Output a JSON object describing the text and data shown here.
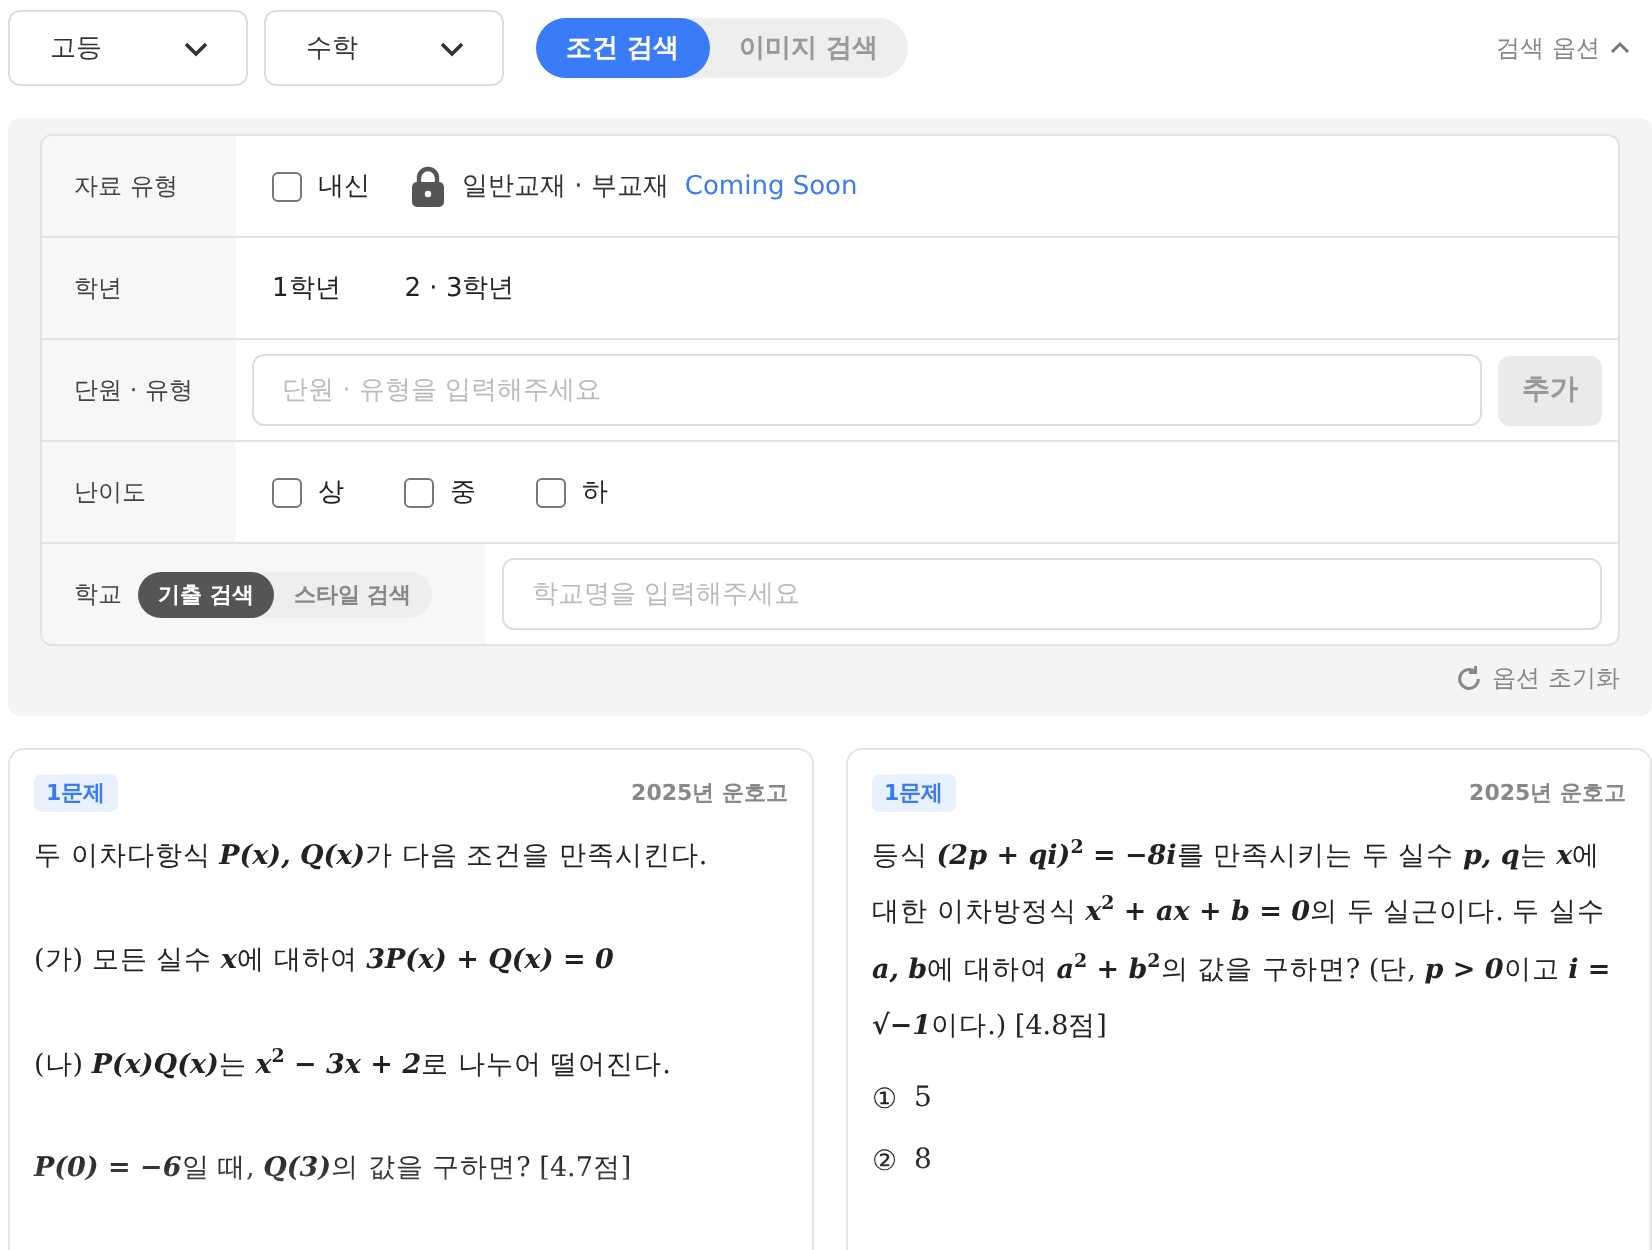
{
  "top_bar": {
    "dropdowns": [
      {
        "label": "고등"
      },
      {
        "label": "수학"
      }
    ],
    "search_tabs": [
      {
        "label": "조건 검색",
        "selected": true
      },
      {
        "label": "이미지 검색",
        "selected": false
      }
    ],
    "options_toggle": {
      "label": "검색 옵션",
      "expanded": true
    }
  },
  "filters": {
    "material": {
      "label": "자료 유형",
      "checkbox": {
        "label": "내신",
        "checked": false
      },
      "locked_label": "일반교재 · 부교재",
      "badge": "Coming Soon"
    },
    "grade": {
      "label": "학년",
      "options": [
        "1학년",
        "2 · 3학년"
      ]
    },
    "unit": {
      "label": "단원 · 유형",
      "placeholder": "단원 · 유형을 입력해주세요",
      "button": "추가"
    },
    "difficulty": {
      "label": "난이도",
      "options": [
        {
          "label": "상",
          "checked": false
        },
        {
          "label": "중",
          "checked": false
        },
        {
          "label": "하",
          "checked": false
        }
      ]
    },
    "school": {
      "label": "학교",
      "modes": [
        {
          "label": "기출 검색",
          "selected": true
        },
        {
          "label": "스타일 검색",
          "selected": false
        }
      ],
      "placeholder": "학교명을 입력해주세요"
    },
    "reset": "옵션 초기화"
  },
  "cards": [
    {
      "badge": "1문제",
      "source": "2025년 운호고",
      "lines": [
        [
          {
            "kind": "text",
            "text": "두 이차다항식 "
          },
          {
            "kind": "math",
            "text": "P(x), Q(x)"
          },
          {
            "kind": "text",
            "text": "가 다음 조건을 만족시킨다."
          }
        ],
        [
          {
            "kind": "text",
            "text": "(가) 모든 실수 "
          },
          {
            "kind": "math",
            "text": "x"
          },
          {
            "kind": "text",
            "text": "에 대하여 "
          },
          {
            "kind": "math",
            "text": "3P(x) + Q(x) = 0"
          }
        ],
        [
          {
            "kind": "text",
            "text": "(나) "
          },
          {
            "kind": "math",
            "text": "P(x)Q(x)"
          },
          {
            "kind": "text",
            "text": "는 "
          },
          {
            "kind": "math",
            "text": "x"
          },
          {
            "kind": "sup",
            "text": "2"
          },
          {
            "kind": "math",
            "text": " − 3x + 2"
          },
          {
            "kind": "text",
            "text": "로 나누어 떨어진다."
          }
        ],
        [
          {
            "kind": "math",
            "text": "P(0) = −6"
          },
          {
            "kind": "text",
            "text": "일 때, "
          },
          {
            "kind": "math",
            "text": "Q(3)"
          },
          {
            "kind": "text",
            "text": "의 값을 구하면? [4.7점]"
          }
        ]
      ]
    },
    {
      "badge": "1문제",
      "source": "2025년 운호고",
      "lines": [
        [
          {
            "kind": "text",
            "text": "등식 "
          },
          {
            "kind": "math",
            "text": "(2p + qi)"
          },
          {
            "kind": "sup",
            "text": "2"
          },
          {
            "kind": "math",
            "text": " = −8i"
          },
          {
            "kind": "text",
            "text": "를 만족시키는 두 실수 "
          },
          {
            "kind": "math",
            "text": "p, q"
          },
          {
            "kind": "text",
            "text": "는 "
          },
          {
            "kind": "math",
            "text": "x"
          },
          {
            "kind": "text",
            "text": "에 대한 이차방정식 "
          },
          {
            "kind": "math",
            "text": "x"
          },
          {
            "kind": "sup",
            "text": "2"
          },
          {
            "kind": "math",
            "text": " + ax + b = 0"
          },
          {
            "kind": "text",
            "text": "의 두 실근이다. 두 실수 "
          },
          {
            "kind": "math",
            "text": "a, b"
          },
          {
            "kind": "text",
            "text": "에 대하여 "
          },
          {
            "kind": "math",
            "text": "a"
          },
          {
            "kind": "sup",
            "text": "2"
          },
          {
            "kind": "math",
            "text": " + b"
          },
          {
            "kind": "sup",
            "text": "2"
          },
          {
            "kind": "text",
            "text": "의 값을 구하면? (단, "
          },
          {
            "kind": "math",
            "text": "p > 0"
          },
          {
            "kind": "text",
            "text": "이고 "
          },
          {
            "kind": "math",
            "text": "i = √−1"
          },
          {
            "kind": "text",
            "text": "이다.) [4.8점]"
          }
        ]
      ],
      "choices": [
        {
          "mark": "①",
          "text": "5"
        },
        {
          "mark": "②",
          "text": "8"
        }
      ]
    }
  ]
}
